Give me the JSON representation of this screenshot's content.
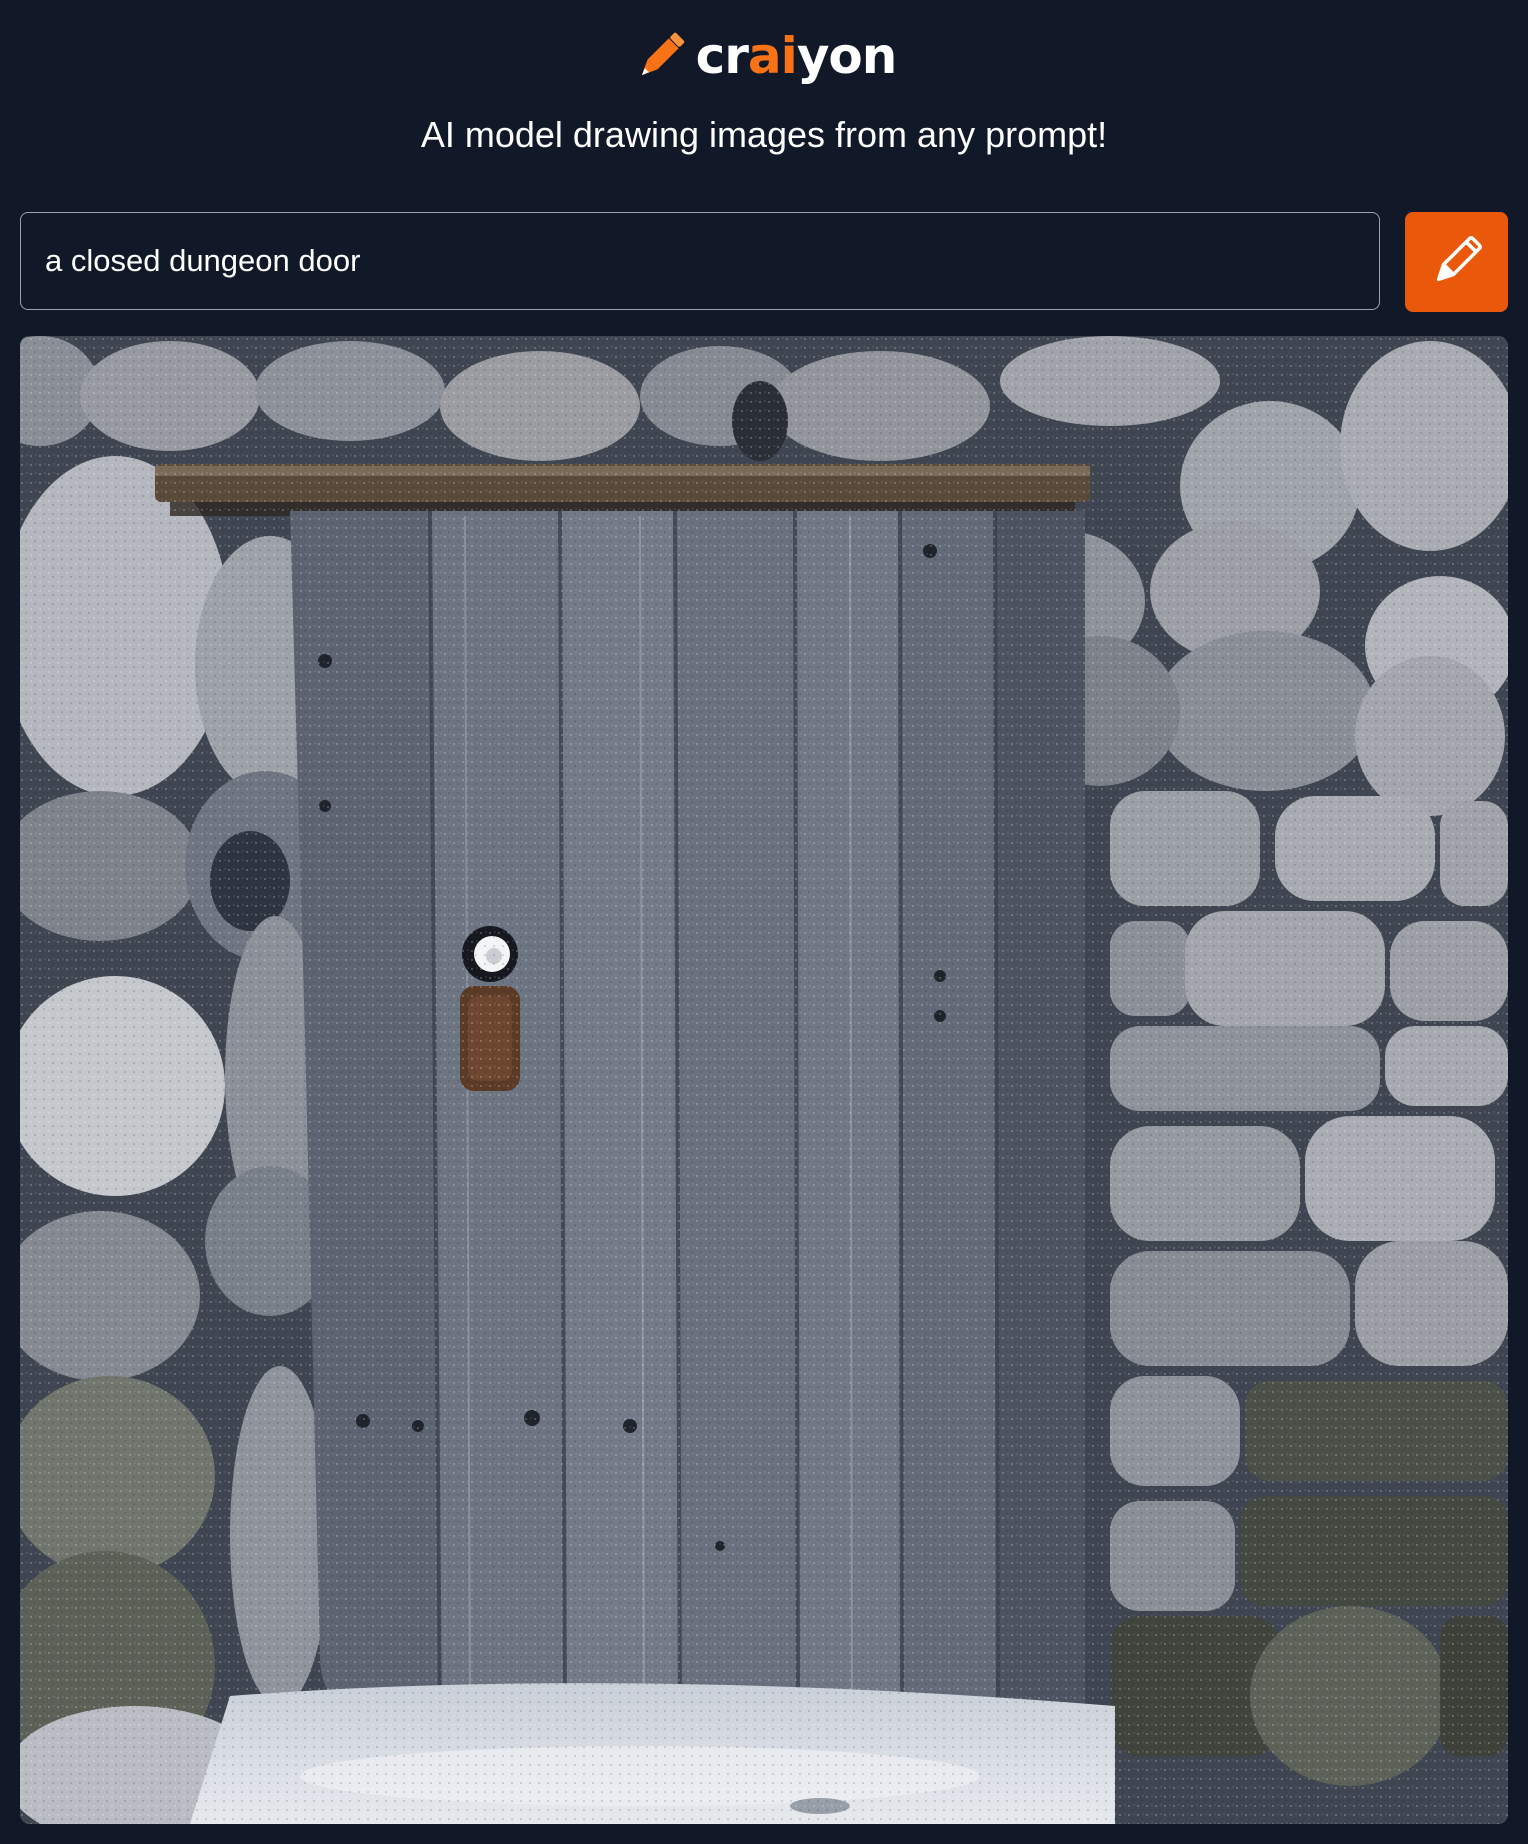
{
  "header": {
    "logo": {
      "text_before": "cr",
      "text_accent": "ai",
      "text_after": "yon",
      "icon": "pencil-icon"
    },
    "tagline": "AI model drawing images from any prompt!"
  },
  "prompt": {
    "value": "a closed dungeon door",
    "submit_icon": "pencil-icon"
  },
  "result": {
    "image_subject": "a closed dungeon door"
  },
  "colors": {
    "background": "#111827",
    "accent": "#ea580c",
    "logo_accent": "#f97316",
    "text": "#ffffff",
    "input_border": "#9ca3af"
  }
}
